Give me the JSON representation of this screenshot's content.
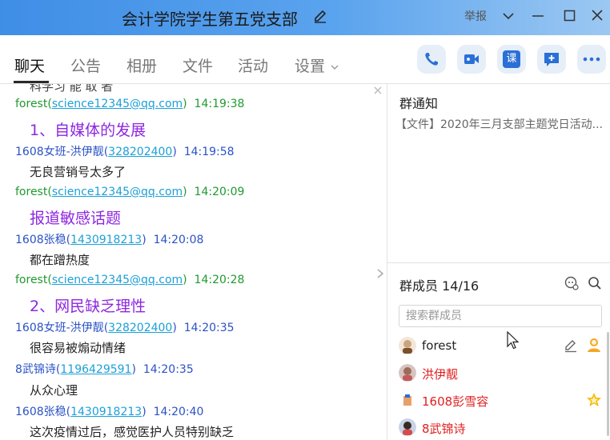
{
  "titlebar": {
    "title": "会计学院学生第五党支部",
    "report_label": "举报"
  },
  "tabs": [
    {
      "label": "聊天",
      "active": true
    },
    {
      "label": "公告"
    },
    {
      "label": "相册"
    },
    {
      "label": "文件"
    },
    {
      "label": "活动"
    },
    {
      "label": "设置"
    }
  ],
  "toolbar": {
    "icons": [
      "phone-icon",
      "video-icon",
      "class-icon",
      "add-chat-icon",
      "more-icon"
    ],
    "class_label": "课",
    "accent": "#2a6fd6"
  },
  "chat": {
    "partial_top": "科学习 能 取 者",
    "messages": [
      {
        "sender": "forest",
        "qq": "science12345@qq.com",
        "time": "14:19:38",
        "text": "1、自媒体的发展",
        "big": true,
        "sender_color": "green"
      },
      {
        "sender": "1608女班-洪伊靓",
        "qq": "328202400",
        "time": "14:19:58",
        "text": "无良营销号太多了",
        "big": false,
        "sender_color": "blue"
      },
      {
        "sender": "forest",
        "qq": "science12345@qq.com",
        "time": "14:20:09",
        "text": "报道敏感话题",
        "big": true,
        "sender_color": "green"
      },
      {
        "sender": "1608张稳",
        "qq": "1430918213",
        "time": "14:20:08",
        "text": "都在蹭热度",
        "big": false,
        "sender_color": "blue"
      },
      {
        "sender": "forest",
        "qq": "science12345@qq.com",
        "time": "14:20:28",
        "text": "2、网民缺乏理性",
        "big": true,
        "sender_color": "green"
      },
      {
        "sender": "1608女班-洪伊靓",
        "qq": "328202400",
        "time": "14:20:35",
        "text": "很容易被煽动情绪",
        "big": false,
        "sender_color": "blue"
      },
      {
        "sender": "8武锦诗",
        "qq": "1196429591",
        "time": "14:20:35",
        "text": "从众心理",
        "big": false,
        "sender_color": "blue"
      },
      {
        "sender": "1608张稳",
        "qq": "1430918213",
        "time": "14:20:40",
        "text": "这次疫情过后，感觉医护人员特别缺乏",
        "big": false,
        "sender_color": "blue"
      }
    ]
  },
  "side": {
    "notice_title": "群通知",
    "notice_text": "【文件】2020年三月支部主题党日活动...",
    "members_title": "群成员 14/16",
    "search_placeholder": "搜索群成员",
    "members": [
      {
        "name": "forest",
        "color": "#222222"
      },
      {
        "name": "洪伊靓",
        "color": "#e02020"
      },
      {
        "name": "1608彭雪容",
        "color": "#e02020"
      },
      {
        "name": "8武锦诗",
        "color": "#e02020"
      }
    ]
  }
}
